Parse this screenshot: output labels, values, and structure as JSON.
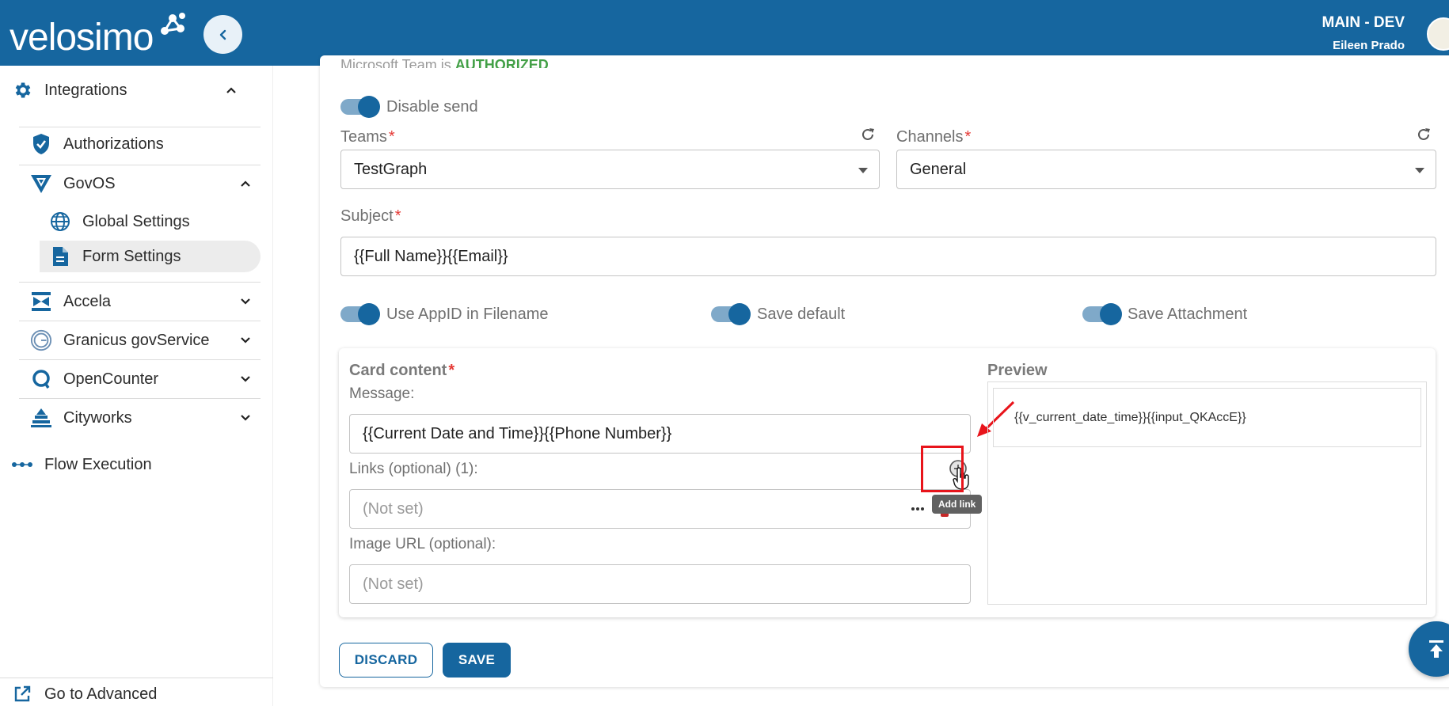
{
  "header": {
    "logo": "velosimo",
    "env_name": "MAIN - DEV",
    "user_name": "Eileen Prado",
    "brand_color": "#16669f"
  },
  "sidebar": {
    "integrations": "Integrations",
    "authorizations": "Authorizations",
    "govos": "GovOS",
    "global_settings": "Global Settings",
    "form_settings": "Form Settings",
    "accela": "Accela",
    "granicus": "Granicus govService",
    "opencounter": "OpenCounter",
    "cityworks": "Cityworks",
    "flow_execution": "Flow Execution",
    "go_advanced": "Go to Advanced"
  },
  "form": {
    "auth_prefix": "Microsoft Team is ",
    "auth_status": "AUTHORIZED",
    "disable_send": "Disable send",
    "teams_label": "Teams",
    "teams_value": "TestGraph",
    "channels_label": "Channels",
    "channels_value": "General",
    "subject_label": "Subject",
    "subject_value": "{{Full Name}}{{Email}}",
    "use_appid": "Use AppID in Filename",
    "save_default": "Save default",
    "save_attachment": "Save Attachment",
    "required_mark": "*"
  },
  "card": {
    "title": "Card content",
    "message_label": "Message:",
    "message_value": "{{Current Date and Time}}{{Phone Number}}",
    "links_label": "Links (optional) (1):",
    "link_placeholder": "(Not set)",
    "image_label": "Image URL (optional):",
    "image_placeholder": "(Not set)",
    "add_link_tooltip": "Add link",
    "preview_label": "Preview",
    "preview_value": "{{v_current_date_time}}{{input_QKAccE}}"
  },
  "actions": {
    "discard": "DISCARD",
    "save": "SAVE"
  }
}
